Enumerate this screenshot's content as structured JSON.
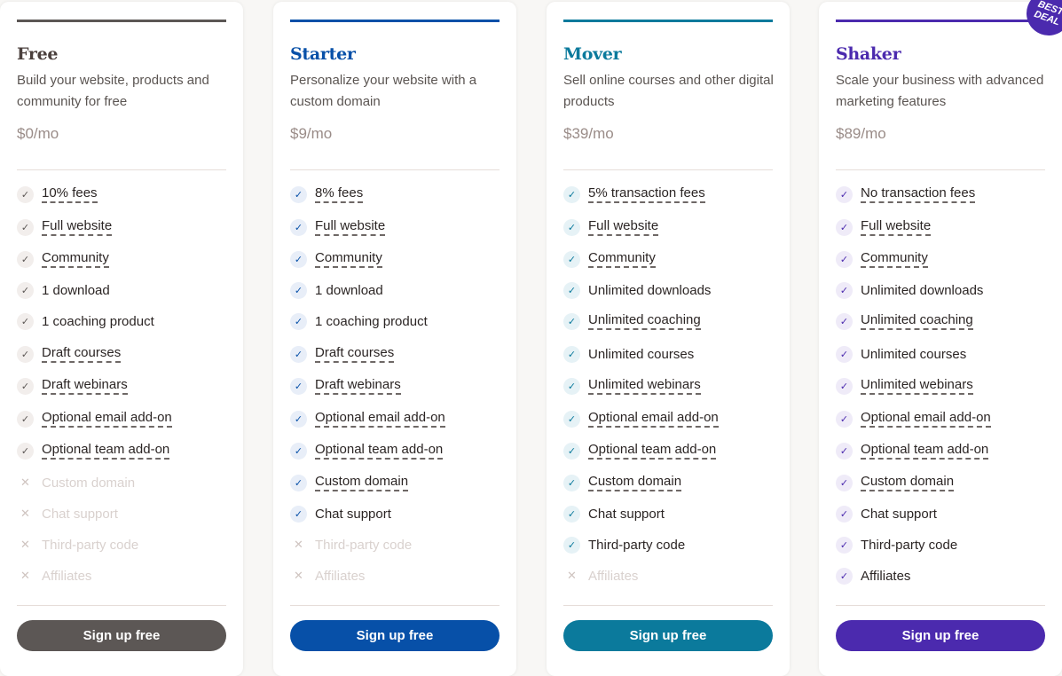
{
  "plans": [
    {
      "name": "Free",
      "description": "Build your website, products and community for free",
      "price": "$0/mo",
      "accent": "#5c5755",
      "check_bg": "#f2eeec",
      "check_color": "#5c5755",
      "cta_label": "Sign up free",
      "features": [
        {
          "label": "10% fees",
          "included": true,
          "tooltip": true
        },
        {
          "label": "Full website",
          "included": true,
          "tooltip": true
        },
        {
          "label": "Community",
          "included": true,
          "tooltip": true
        },
        {
          "label": "1 download",
          "included": true,
          "tooltip": false
        },
        {
          "label": "1 coaching product",
          "included": true,
          "tooltip": false
        },
        {
          "label": "Draft courses",
          "included": true,
          "tooltip": true
        },
        {
          "label": "Draft webinars",
          "included": true,
          "tooltip": true
        },
        {
          "label": "Optional email add-on",
          "included": true,
          "tooltip": true
        },
        {
          "label": "Optional team add-on",
          "included": true,
          "tooltip": true
        },
        {
          "label": "Custom domain",
          "included": false,
          "tooltip": false
        },
        {
          "label": "Chat support",
          "included": false,
          "tooltip": false
        },
        {
          "label": "Third-party code",
          "included": false,
          "tooltip": false
        },
        {
          "label": "Affiliates",
          "included": false,
          "tooltip": false
        }
      ]
    },
    {
      "name": "Starter",
      "description": "Personalize your website with a custom domain",
      "price": "$9/mo",
      "accent": "#0750a8",
      "check_bg": "#e8eef8",
      "check_color": "#0750a8",
      "cta_label": "Sign up free",
      "features": [
        {
          "label": "8% fees",
          "included": true,
          "tooltip": true
        },
        {
          "label": "Full website",
          "included": true,
          "tooltip": true
        },
        {
          "label": "Community",
          "included": true,
          "tooltip": true
        },
        {
          "label": "1 download",
          "included": true,
          "tooltip": false
        },
        {
          "label": "1 coaching product",
          "included": true,
          "tooltip": false
        },
        {
          "label": "Draft courses",
          "included": true,
          "tooltip": true
        },
        {
          "label": "Draft webinars",
          "included": true,
          "tooltip": true
        },
        {
          "label": "Optional email add-on",
          "included": true,
          "tooltip": true
        },
        {
          "label": "Optional team add-on",
          "included": true,
          "tooltip": true
        },
        {
          "label": "Custom domain",
          "included": true,
          "tooltip": true
        },
        {
          "label": "Chat support",
          "included": true,
          "tooltip": false
        },
        {
          "label": "Third-party code",
          "included": false,
          "tooltip": false
        },
        {
          "label": "Affiliates",
          "included": false,
          "tooltip": false
        }
      ]
    },
    {
      "name": "Mover",
      "description": "Sell online courses and other digital products",
      "price": "$39/mo",
      "accent": "#0b7a9c",
      "check_bg": "#e6f2f6",
      "check_color": "#0b7a9c",
      "cta_label": "Sign up free",
      "features": [
        {
          "label": "5% transaction fees",
          "included": true,
          "tooltip": true
        },
        {
          "label": "Full website",
          "included": true,
          "tooltip": true
        },
        {
          "label": "Community",
          "included": true,
          "tooltip": true
        },
        {
          "label": "Unlimited downloads",
          "included": true,
          "tooltip": false
        },
        {
          "label": "Unlimited coaching",
          "included": true,
          "tooltip": true
        },
        {
          "label": "Unlimited courses",
          "included": true,
          "tooltip": false
        },
        {
          "label": "Unlimited webinars",
          "included": true,
          "tooltip": true
        },
        {
          "label": "Optional email add-on",
          "included": true,
          "tooltip": true
        },
        {
          "label": "Optional team add-on",
          "included": true,
          "tooltip": true
        },
        {
          "label": "Custom domain",
          "included": true,
          "tooltip": true
        },
        {
          "label": "Chat support",
          "included": true,
          "tooltip": false
        },
        {
          "label": "Third-party code",
          "included": true,
          "tooltip": false
        },
        {
          "label": "Affiliates",
          "included": false,
          "tooltip": false
        }
      ]
    },
    {
      "name": "Shaker",
      "description": "Scale your business with advanced marketing features",
      "price": "$89/mo",
      "accent": "#4b2aae",
      "check_bg": "#efebf8",
      "check_color": "#4b2aae",
      "cta_label": "Sign up free",
      "badge": [
        "BEST",
        "DEAL"
      ],
      "features": [
        {
          "label": "No transaction fees",
          "included": true,
          "tooltip": true
        },
        {
          "label": "Full website",
          "included": true,
          "tooltip": true
        },
        {
          "label": "Community",
          "included": true,
          "tooltip": true
        },
        {
          "label": "Unlimited downloads",
          "included": true,
          "tooltip": false
        },
        {
          "label": "Unlimited coaching",
          "included": true,
          "tooltip": true
        },
        {
          "label": "Unlimited courses",
          "included": true,
          "tooltip": false
        },
        {
          "label": "Unlimited webinars",
          "included": true,
          "tooltip": true
        },
        {
          "label": "Optional email add-on",
          "included": true,
          "tooltip": true
        },
        {
          "label": "Optional team add-on",
          "included": true,
          "tooltip": true
        },
        {
          "label": "Custom domain",
          "included": true,
          "tooltip": true
        },
        {
          "label": "Chat support",
          "included": true,
          "tooltip": false
        },
        {
          "label": "Third-party code",
          "included": true,
          "tooltip": false
        },
        {
          "label": "Affiliates",
          "included": true,
          "tooltip": false
        }
      ]
    }
  ],
  "icons": {
    "check": "✓",
    "cross": "✕"
  }
}
